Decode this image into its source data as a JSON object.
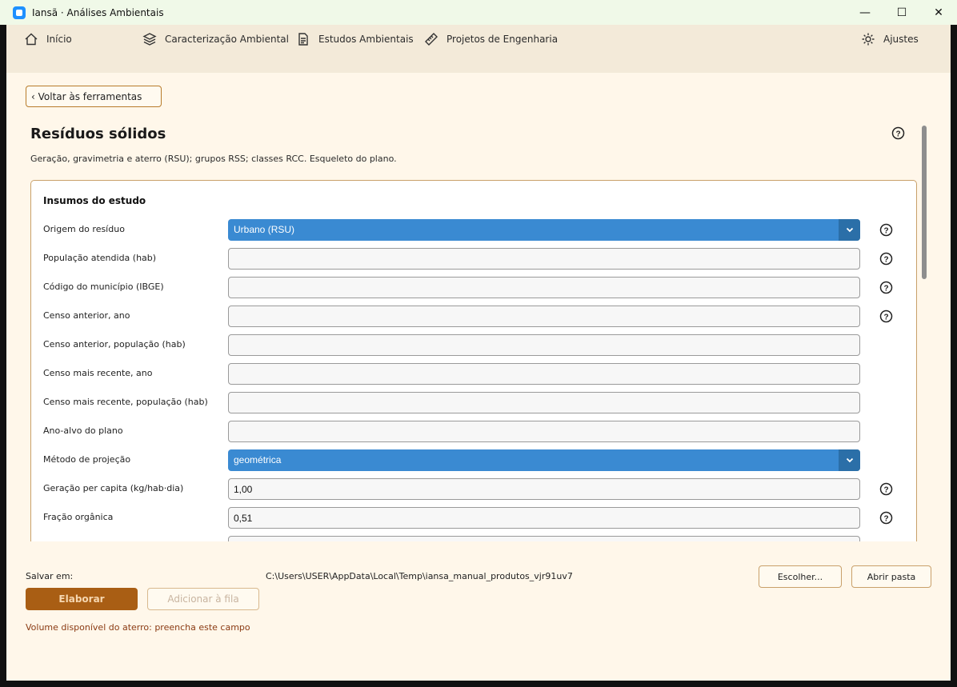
{
  "window": {
    "title": "Iansã · Análises Ambientais",
    "controls": [
      "—",
      "☐",
      "✕"
    ]
  },
  "nav": {
    "items": [
      {
        "label": "Início",
        "icon": "home-icon"
      },
      {
        "label": "Caracterização Ambiental",
        "icon": "layers-icon"
      },
      {
        "label": "Estudos Ambientais",
        "icon": "document-icon"
      },
      {
        "label": "Projetos de Engenharia",
        "icon": "ruler-icon"
      }
    ],
    "settings": {
      "label": "Ajustes",
      "icon": "gear-icon"
    }
  },
  "back_button": "‹ Voltar às ferramentas",
  "page": {
    "title": "Resíduos sólidos",
    "subtitle": "Geração, gravimetria e aterro (RSU); grupos RSS; classes RCC. Esqueleto do plano."
  },
  "inputs": {
    "title": "Insumos do estudo",
    "fields": [
      {
        "label": "Origem do resíduo",
        "type": "select",
        "value": "Urbano (RSU)",
        "help": true
      },
      {
        "label": "População atendida (hab)",
        "type": "text",
        "value": "",
        "help": true
      },
      {
        "label": "Código do município (IBGE)",
        "type": "text",
        "value": "",
        "help": true
      },
      {
        "label": "Censo anterior, ano",
        "type": "text",
        "value": "",
        "help": true
      },
      {
        "label": "Censo anterior, população (hab)",
        "type": "text",
        "value": "",
        "help": false
      },
      {
        "label": "Censo mais recente, ano",
        "type": "text",
        "value": "",
        "help": false
      },
      {
        "label": "Censo mais recente, população (hab)",
        "type": "text",
        "value": "",
        "help": false
      },
      {
        "label": "Ano-alvo do plano",
        "type": "text",
        "value": "",
        "help": false
      },
      {
        "label": "Método de projeção",
        "type": "select",
        "value": "geométrica",
        "help": false
      },
      {
        "label": "Geração per capita (kg/hab·dia)",
        "type": "text",
        "value": "1,00",
        "help": true
      },
      {
        "label": "Fração orgânica",
        "type": "text",
        "value": "0,51",
        "help": true
      },
      {
        "label": "",
        "type": "text",
        "value": "",
        "help": false
      }
    ]
  },
  "footer": {
    "save_label": "Salvar em:",
    "path": "C:\\Users\\USER\\AppData\\Local\\Temp\\iansa_manual_produtos_vjr91uv7",
    "choose": "Escolher...",
    "open_folder": "Abrir pasta",
    "elaborate": "Elaborar",
    "add_queue": "Adicionar à fila",
    "error": "Volume disponível do aterro: preencha este campo"
  },
  "colors": {
    "accent": "#a95e14",
    "select_bg": "#3a8ad2",
    "page_bg": "#fff7ea"
  }
}
